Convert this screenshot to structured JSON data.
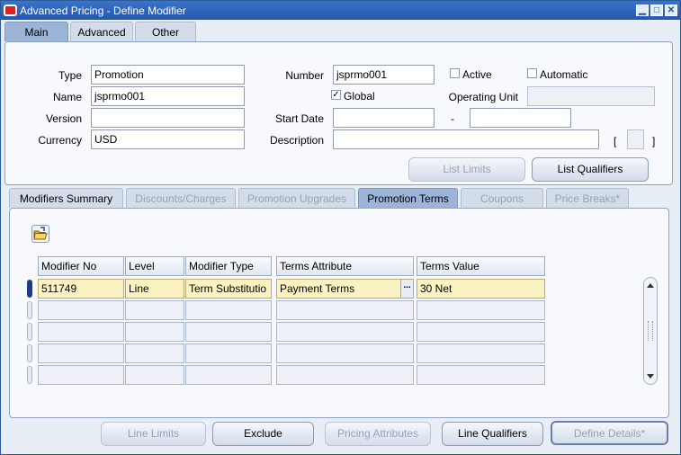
{
  "window": {
    "title": "Advanced Pricing - Define Modifier",
    "min_label": "▁",
    "max_label": "□",
    "close_label": "✕"
  },
  "top_tabs": [
    {
      "label": "Main",
      "active": true
    },
    {
      "label": "Advanced",
      "active": false
    },
    {
      "label": "Other",
      "active": false
    }
  ],
  "header": {
    "type_label": "Type",
    "type_value": "Promotion",
    "name_label": "Name",
    "name_value": "jsprmo001",
    "version_label": "Version",
    "version_value": "",
    "currency_label": "Currency",
    "currency_value": "USD",
    "number_label": "Number",
    "number_value": "jsprmo001",
    "active_label": "Active",
    "active_checked": false,
    "automatic_label": "Automatic",
    "automatic_checked": false,
    "global_label": "Global",
    "global_checked": true,
    "operating_unit_label": "Operating Unit",
    "operating_unit_value": "",
    "start_date_label": "Start Date",
    "start_date_value": "",
    "date_separator": "-",
    "end_date_value": "",
    "description_label": "Description",
    "description_value": "",
    "dff_open": "[",
    "dff_close": "]",
    "list_limits_label": "List Limits",
    "list_qualifiers_label": "List Qualifiers"
  },
  "lower_tabs": [
    {
      "label": "Modifiers Summary",
      "state": "normal"
    },
    {
      "label": "Discounts/Charges",
      "state": "disabled"
    },
    {
      "label": "Promotion Upgrades",
      "state": "disabled"
    },
    {
      "label": "Promotion Terms",
      "state": "active"
    },
    {
      "label": "Coupons",
      "state": "disabled"
    },
    {
      "label": "Price Breaks*",
      "state": "disabled"
    }
  ],
  "grid": {
    "columns": [
      "Modifier No",
      "Level",
      "Modifier Type",
      "Terms Attribute",
      "Terms Value"
    ],
    "rows": [
      [
        "511749",
        "Line",
        "Term Substitutio",
        "Payment Terms",
        "30 Net"
      ],
      [
        "",
        "",
        "",
        "",
        ""
      ],
      [
        "",
        "",
        "",
        "",
        ""
      ],
      [
        "",
        "",
        "",
        "",
        ""
      ],
      [
        "",
        "",
        "",
        "",
        ""
      ]
    ],
    "lov_label": "..."
  },
  "bottom_buttons": {
    "line_limits": "Line Limits",
    "exclude": "Exclude",
    "pricing_attributes": "Pricing Attributes",
    "line_qualifiers": "Line Qualifiers",
    "define_details": "Define Details*"
  }
}
